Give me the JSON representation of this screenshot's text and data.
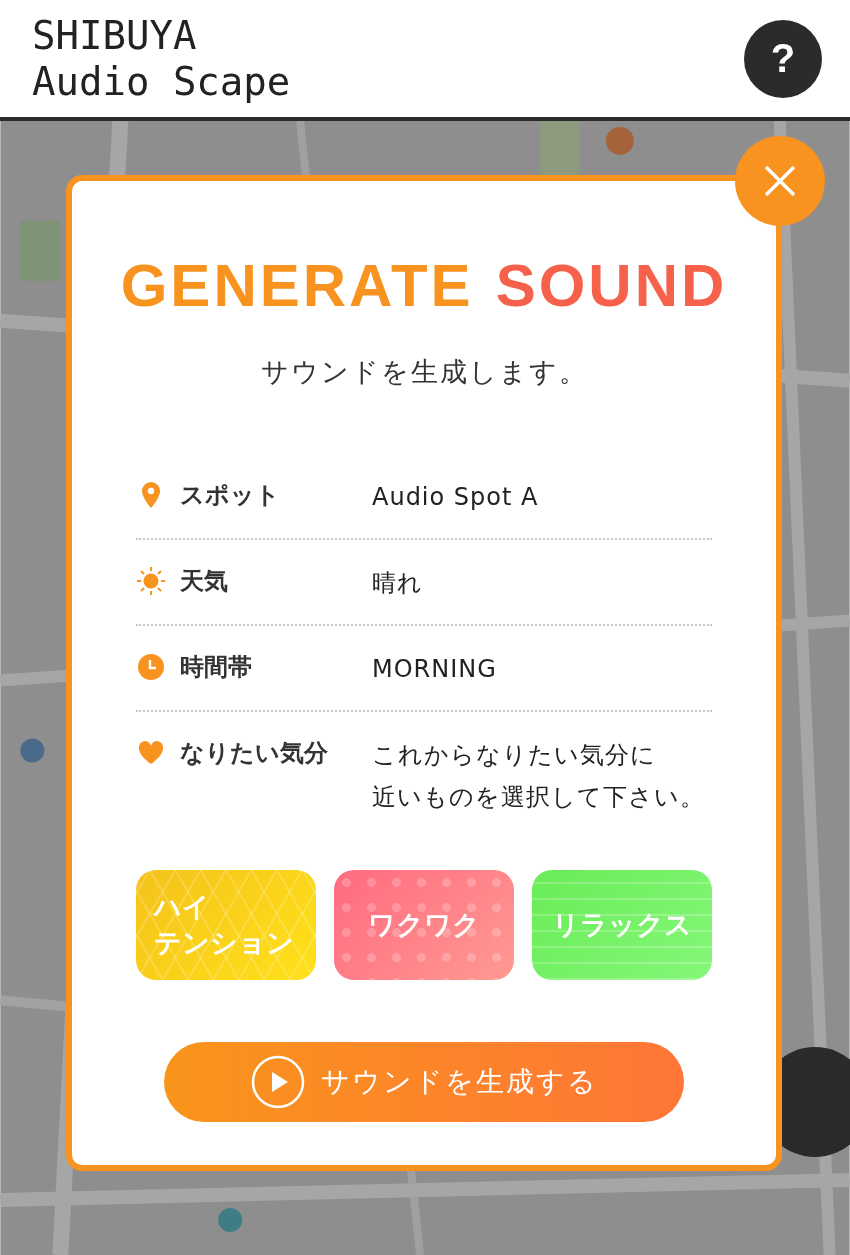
{
  "header": {
    "title_lines": [
      "SHIBUYA",
      "Audio Scape"
    ],
    "help_button": "?"
  },
  "dialog": {
    "title_parts": [
      {
        "text": "GENERATE",
        "color": "#f7931e"
      },
      {
        "text": "SOUND",
        "color": "#f5614b"
      }
    ],
    "subtitle": "サウンドを生成します。",
    "rows": [
      {
        "kind": "pin",
        "label": "スポット",
        "value": "Audio Spot A"
      },
      {
        "kind": "sun",
        "label": "天気",
        "value": "晴れ"
      },
      {
        "kind": "clock",
        "label": "時間帯",
        "value": "MORNING"
      },
      {
        "kind": "heart",
        "label": "なりたい気分",
        "value": "これからなりたい気分に",
        "value_2": "近いものを選択して下さい。"
      }
    ],
    "moods": [
      {
        "kind": "zigzag",
        "label_lines": [
          "ハイ",
          "テンション"
        ]
      },
      {
        "kind": "dots",
        "label_lines": [
          "ワクワク"
        ]
      },
      {
        "kind": "waves",
        "label_lines": [
          "リラックス"
        ]
      }
    ],
    "generate_button": "サウンドを生成する"
  }
}
